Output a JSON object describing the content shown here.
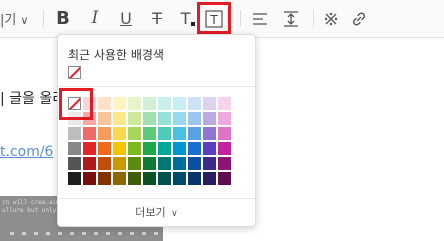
{
  "toolbar": {
    "font_size_fragment": "|기",
    "chevron": "∨",
    "bold": "B",
    "italic": "I",
    "underline": "U",
    "strikethrough": "T",
    "text_color": "T",
    "background_color": "T"
  },
  "document": {
    "text_fragment": "| 글을 올리",
    "link_fragment": "t.com/6",
    "image_caption_1": "rn will crea.aim al tale amari nebit b t itu",
    "image_caption_2": "ullure but only a mouse blast anybody and"
  },
  "picker": {
    "title": "최근 사용한 배경색",
    "more_label": "더보기",
    "more_chevron": "∨",
    "colors": {
      "accent_highlight": "#e31b25"
    },
    "palette": [
      [
        "none",
        "#fad7d7",
        "#fde0c8",
        "#fff5c2",
        "#e8f5c8",
        "#d1f0d6",
        "#c8f0ea",
        "#c8eef7",
        "#cde2f7",
        "#dcd3f2",
        "#f6d3ee"
      ],
      [
        "#e9e9e9",
        "#f7a8a8",
        "#fbc39a",
        "#fde88d",
        "#cde99a",
        "#a3e0b0",
        "#95e3d7",
        "#96d9ef",
        "#9dc6ef",
        "#bcaae5",
        "#ecaadc"
      ],
      [
        "#bdbdbd",
        "#f06a6a",
        "#f89a5a",
        "#fbd84d",
        "#a8d65a",
        "#5cc97b",
        "#4dccbb",
        "#4cc0e4",
        "#5aa2e4",
        "#8e75d6",
        "#df73c5"
      ],
      [
        "#888888",
        "#e12727",
        "#f06a1a",
        "#f5c400",
        "#7cbb1f",
        "#1fa84a",
        "#00a89a",
        "#0096cf",
        "#1a6fd1",
        "#5b3fbf",
        "#c2249e"
      ],
      [
        "#555555",
        "#b11a1a",
        "#c24e0a",
        "#c99a00",
        "#5a8a10",
        "#127a33",
        "#007a70",
        "#006e9a",
        "#0f4f9f",
        "#3d2a8a",
        "#8d1675"
      ],
      [
        "#1f1f1f",
        "#7a0f0f",
        "#853400",
        "#8a6a00",
        "#3d5e0a",
        "#0b5222",
        "#00524b",
        "#004a68",
        "#0a356b",
        "#2a1d5e",
        "#5f0f4f"
      ]
    ]
  }
}
